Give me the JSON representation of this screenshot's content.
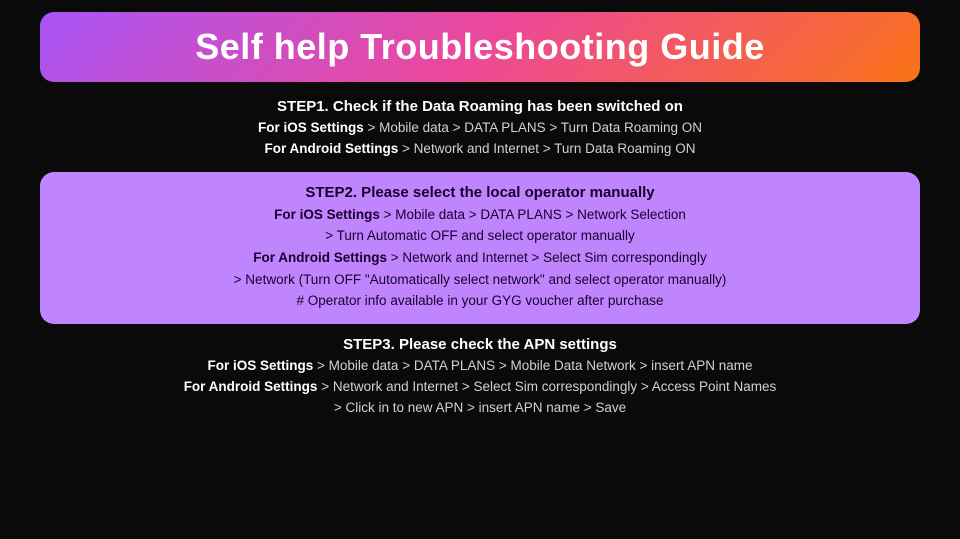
{
  "title": "Self help Troubleshooting Guide",
  "step1": {
    "heading": "STEP1. Check if the Data Roaming has been switched on",
    "line1_bold": "For iOS Settings",
    "line1_rest": " > Mobile data > DATA PLANS > Turn Data Roaming ON",
    "line2_bold": "For Android Settings",
    "line2_rest": " > Network and Internet > Turn Data Roaming ON"
  },
  "step2": {
    "heading": "STEP2. Please select the local operator manually",
    "line1_bold": "For iOS Settings",
    "line1_rest": " > Mobile data > DATA PLANS > Network Selection",
    "line2": "> Turn Automatic OFF and select operator manually",
    "line3_bold": "For Android Settings",
    "line3_rest": " > Network and Internet > Select Sim correspondingly",
    "line4": "> Network (Turn OFF \"Automatically select network\" and select operator manually)",
    "line5": "# Operator info available in your GYG voucher after purchase"
  },
  "step3": {
    "heading": "STEP3. Please check the APN settings",
    "line1_bold": "For iOS Settings",
    "line1_rest": " > Mobile data > DATA PLANS > Mobile Data Network > insert APN name",
    "line2_bold": "For Android Settings",
    "line2_rest": " > Network and Internet > Select Sim correspondingly > Access Point Names",
    "line3": "> Click in to new APN > insert APN name > Save"
  }
}
